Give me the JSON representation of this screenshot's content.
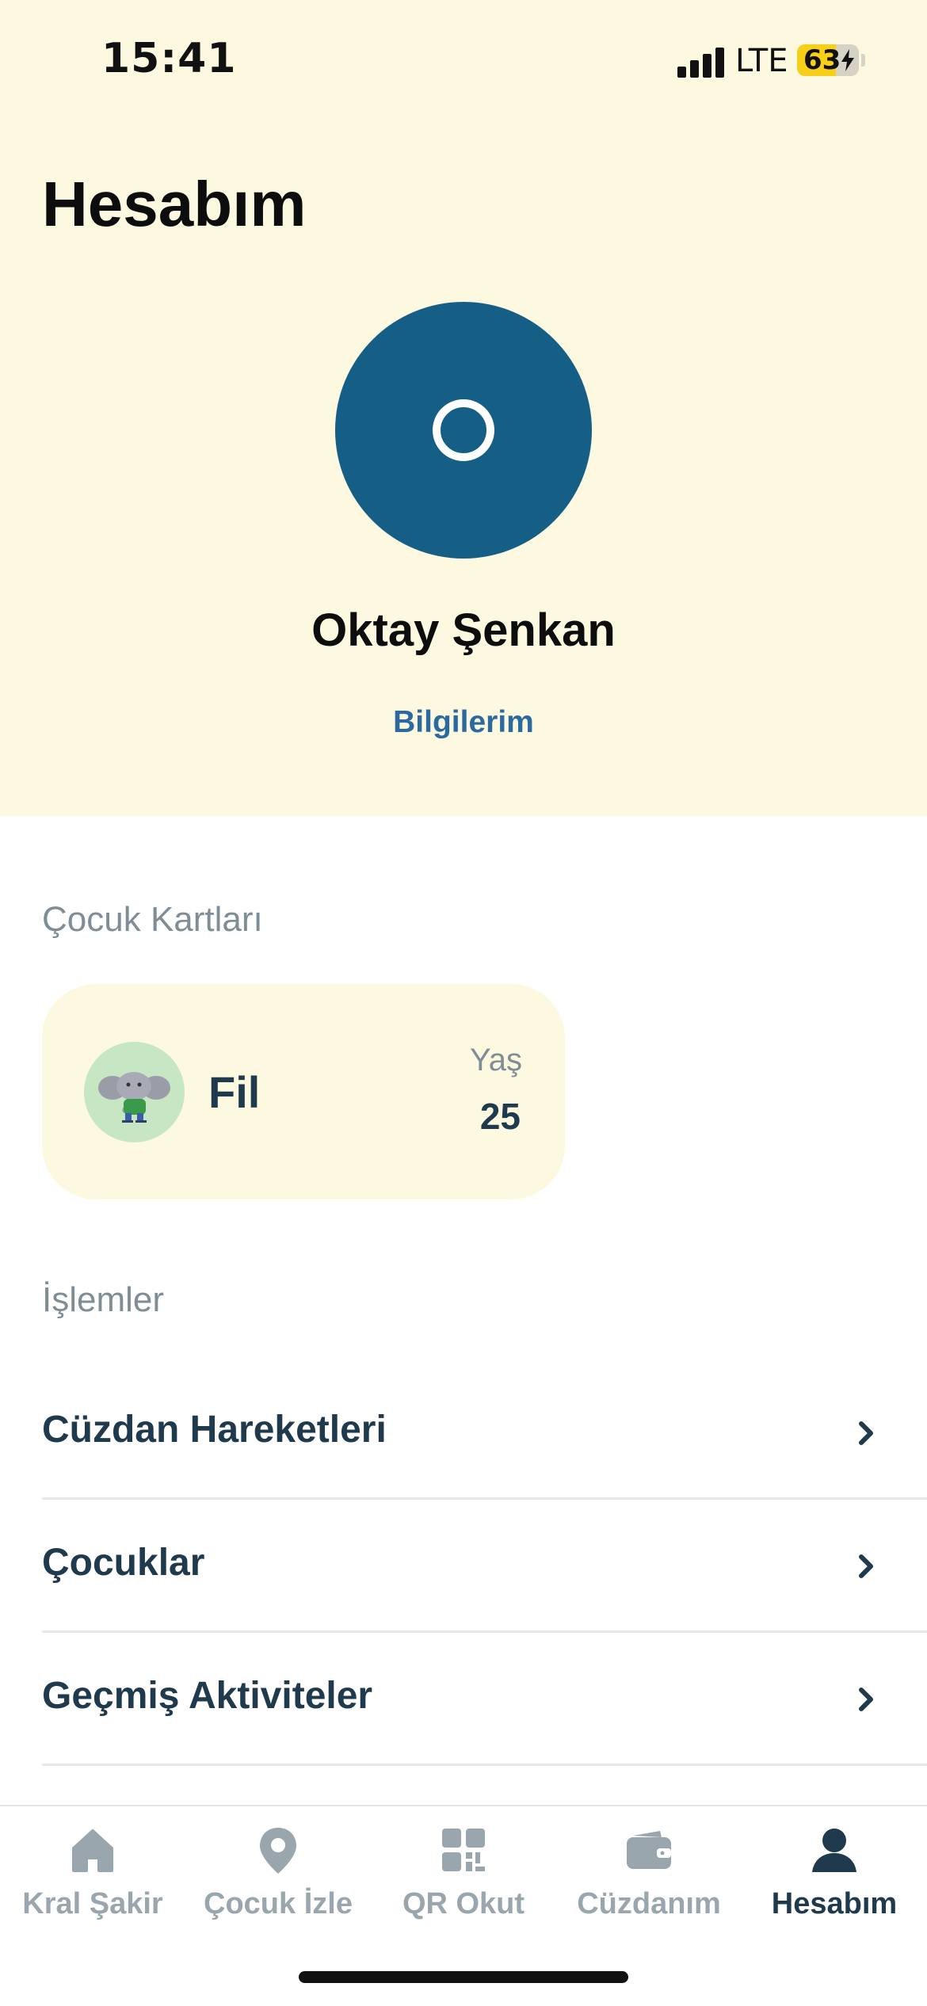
{
  "status_bar": {
    "time": "15:41",
    "network": "LTE",
    "battery": "63",
    "battery_level": 0.63
  },
  "header": {
    "title": "Hesabım"
  },
  "profile": {
    "name": "Oktay Şenkan",
    "info_link": "Bilgilerim",
    "avatar_color": "#155e86"
  },
  "child_cards": {
    "section_title": "Çocuk Kartları",
    "cards": [
      {
        "name": "Fil",
        "age_label": "Yaş",
        "age": "25",
        "avatar_icon": "elephant-icon"
      }
    ]
  },
  "operations": {
    "section_title": "İşlemler",
    "items": [
      {
        "label": "Cüzdan Hareketleri"
      },
      {
        "label": "Çocuklar"
      },
      {
        "label": "Geçmiş Aktiviteler"
      }
    ]
  },
  "tab_bar": {
    "tabs": [
      {
        "label": "Kral Şakir",
        "icon": "home-icon"
      },
      {
        "label": "Çocuk İzle",
        "icon": "location-pin-icon"
      },
      {
        "label": "QR Okut",
        "icon": "qr-code-icon"
      },
      {
        "label": "Cüzdanım",
        "icon": "wallet-icon"
      },
      {
        "label": "Hesabım",
        "icon": "person-icon",
        "active": true
      }
    ]
  },
  "colors": {
    "header_bg": "#fdf9e1",
    "primary_text": "#1f3a4d",
    "link": "#2a6a9f",
    "muted": "#7f8d96",
    "battery_yellow": "#f8cf18"
  }
}
